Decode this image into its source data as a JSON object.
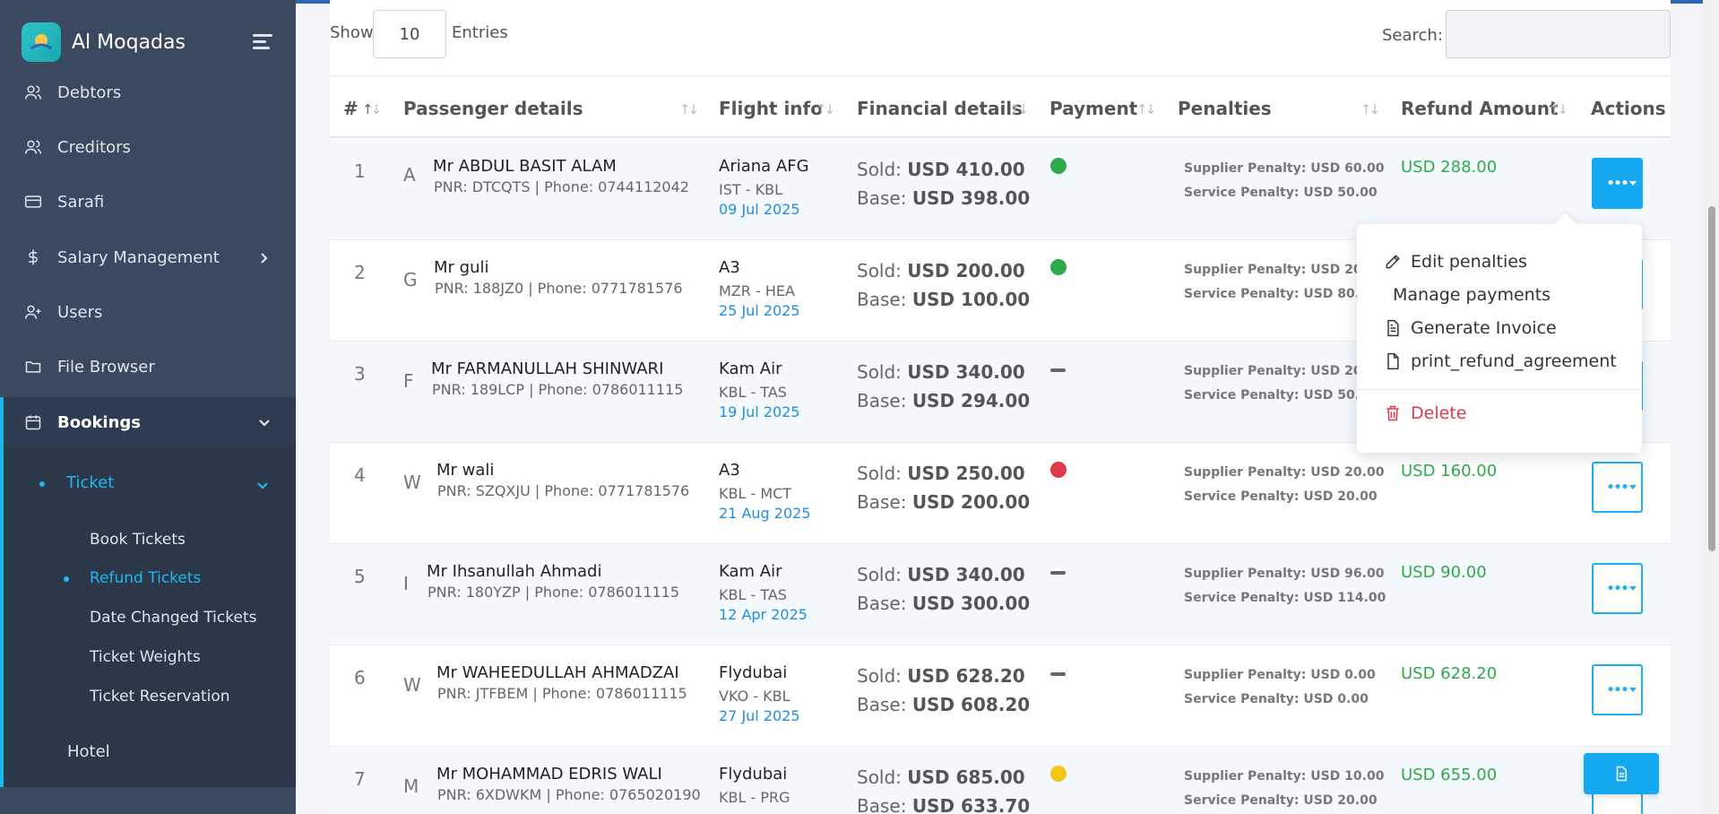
{
  "app": {
    "name": "Al Moqadas"
  },
  "sidebar": {
    "items": [
      {
        "label": "Debtors",
        "icon": "users-icon"
      },
      {
        "label": "Creditors",
        "icon": "users-icon"
      },
      {
        "label": "Sarafi",
        "icon": "credit-card-icon"
      },
      {
        "label": "Salary Management",
        "icon": "dollar-icon"
      },
      {
        "label": "Users",
        "icon": "user-plus-icon"
      },
      {
        "label": "File Browser",
        "icon": "folder-icon"
      },
      {
        "label": "Bookings",
        "icon": "calendar-icon"
      }
    ],
    "ticket_label": "Ticket",
    "ticket_children": [
      "Book Tickets",
      "Refund Tickets",
      "Date Changed Tickets",
      "Ticket Weights",
      "Ticket Reservation"
    ],
    "hotel_label": "Hotel"
  },
  "table_controls": {
    "show_label": "Show",
    "entries_value": "10",
    "entries_label": "Entries",
    "search_label": "Search:"
  },
  "columns": [
    "#",
    "Passenger details",
    "Flight info",
    "Financial details",
    "Payment",
    "Penalties",
    "Refund Amount",
    "Actions"
  ],
  "rows": [
    {
      "num": "1",
      "initial": "A",
      "name": "Mr ABDUL BASIT ALAM",
      "pnr": "PNR: DTCQTS | Phone: 0744112042",
      "airline": "Ariana AFG",
      "route": "IST - KBL",
      "date": "09 Jul 2025",
      "sold_label": "Sold:",
      "sold": "USD 410.00",
      "base_label": "Base:",
      "base": "USD 398.00",
      "payment": "green",
      "supplier_penalty": "Supplier Penalty: USD 60.00",
      "service_penalty": "Service Penalty: USD 50.00",
      "refund": "USD 288.00"
    },
    {
      "num": "2",
      "initial": "G",
      "name": "Mr guli",
      "pnr": "PNR: 188JZ0 | Phone: 0771781576",
      "airline": "A3",
      "route": "MZR - HEA",
      "date": "25 Jul 2025",
      "sold_label": "Sold:",
      "sold": "USD 200.00",
      "base_label": "Base:",
      "base": "USD 100.00",
      "payment": "green",
      "supplier_penalty": "Supplier Penalty: USD 20.00",
      "service_penalty": "Service Penalty: USD 80.00",
      "refund": ""
    },
    {
      "num": "3",
      "initial": "F",
      "name": "Mr FARMANULLAH SHINWARI",
      "pnr": "PNR: 189LCP | Phone: 0786011115",
      "airline": "Kam Air",
      "route": "KBL - TAS",
      "date": "19 Jul 2025",
      "sold_label": "Sold:",
      "sold": "USD 340.00",
      "base_label": "Base:",
      "base": "USD 294.00",
      "payment": "dash",
      "supplier_penalty": "Supplier Penalty: USD 20.00",
      "service_penalty": "Service Penalty: USD 50.00",
      "refund": ""
    },
    {
      "num": "4",
      "initial": "W",
      "name": "Mr wali",
      "pnr": "PNR: SZQXJU | Phone: 0771781576",
      "airline": "A3",
      "route": "KBL - MCT",
      "date": "21 Aug 2025",
      "sold_label": "Sold:",
      "sold": "USD 250.00",
      "base_label": "Base:",
      "base": "USD 200.00",
      "payment": "red",
      "supplier_penalty": "Supplier Penalty: USD 20.00",
      "service_penalty": "Service Penalty: USD 20.00",
      "refund": "USD 160.00"
    },
    {
      "num": "5",
      "initial": "I",
      "name": "Mr Ihsanullah Ahmadi",
      "pnr": "PNR: 180YZP | Phone: 0786011115",
      "airline": "Kam Air",
      "route": "KBL - TAS",
      "date": "12 Apr 2025",
      "sold_label": "Sold:",
      "sold": "USD 340.00",
      "base_label": "Base:",
      "base": "USD 300.00",
      "payment": "dash",
      "supplier_penalty": "Supplier Penalty: USD 96.00",
      "service_penalty": "Service Penalty: USD 114.00",
      "refund": "USD 90.00"
    },
    {
      "num": "6",
      "initial": "W",
      "name": "Mr WAHEEDULLAH AHMADZAI",
      "pnr": "PNR: JTFBEM | Phone: 0786011115",
      "airline": "Flydubai",
      "route": "VKO - KBL",
      "date": "27 Jul 2025",
      "sold_label": "Sold:",
      "sold": "USD 628.20",
      "base_label": "Base:",
      "base": "USD 608.20",
      "payment": "dash",
      "supplier_penalty": "Supplier Penalty: USD 0.00",
      "service_penalty": "Service Penalty: USD 0.00",
      "refund": "USD 628.20"
    },
    {
      "num": "7",
      "initial": "M",
      "name": "Mr MOHAMMAD EDRIS WALI",
      "pnr": "PNR: 6XDWKM | Phone: 0765020190",
      "airline": "Flydubai",
      "route": "KBL - PRG",
      "date": "",
      "sold_label": "Sold:",
      "sold": "USD 685.00",
      "base_label": "Base:",
      "base": "USD 633.70",
      "payment": "yellow",
      "supplier_penalty": "Supplier Penalty: USD 10.00",
      "service_penalty": "Service Penalty: USD 20.00",
      "refund": "USD 655.00"
    }
  ],
  "dropdown": {
    "edit_penalties": "Edit penalties",
    "manage_payments": "Manage payments",
    "generate_invoice": "Generate Invoice",
    "print_refund_agreement": "print_refund_agreement",
    "delete": "Delete"
  },
  "colors": {
    "accent": "#14a9f1",
    "sidebar": "#3a4860",
    "refund": "#2eaa4a",
    "danger": "#e0394b",
    "green": "#2eaa4a",
    "red": "#e0394b",
    "yellow": "#f5c518"
  }
}
